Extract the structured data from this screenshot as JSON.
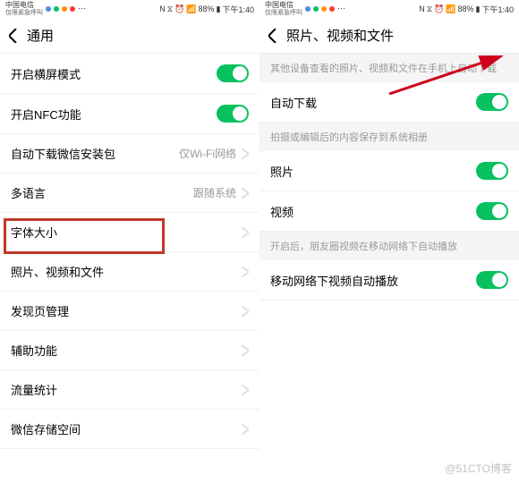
{
  "statusbar": {
    "carrier_main": "中国电信",
    "carrier_sub": "仅限紧急呼叫",
    "battery": "88%",
    "time": "下午1:40"
  },
  "left": {
    "title": "通用",
    "rows": [
      {
        "label": "开启横屏模式",
        "type": "toggle",
        "on": true
      },
      {
        "label": "开启NFC功能",
        "type": "toggle",
        "on": true
      },
      {
        "label": "自动下载微信安装包",
        "type": "value",
        "value": "仅Wi-Fi网络"
      },
      {
        "label": "多语言",
        "type": "value",
        "value": "跟随系统"
      },
      {
        "label": "字体大小",
        "type": "link"
      },
      {
        "label": "照片、视频和文件",
        "type": "link"
      },
      {
        "label": "发现页管理",
        "type": "link"
      },
      {
        "label": "辅助功能",
        "type": "link"
      },
      {
        "label": "流量统计",
        "type": "link"
      },
      {
        "label": "微信存储空间",
        "type": "link"
      }
    ]
  },
  "right": {
    "title": "照片、视频和文件",
    "section1": "其他设备查看的照片、视频和文件在手机上自动下载",
    "row1": "自动下载",
    "section2": "拍摄或编辑后的内容保存到系统相册",
    "row2": "照片",
    "row3": "视频",
    "section3": "开启后，朋友圈视频在移动网络下自动播放",
    "row4": "移动网络下视频自动播放"
  },
  "watermark": "@51CTO博客"
}
